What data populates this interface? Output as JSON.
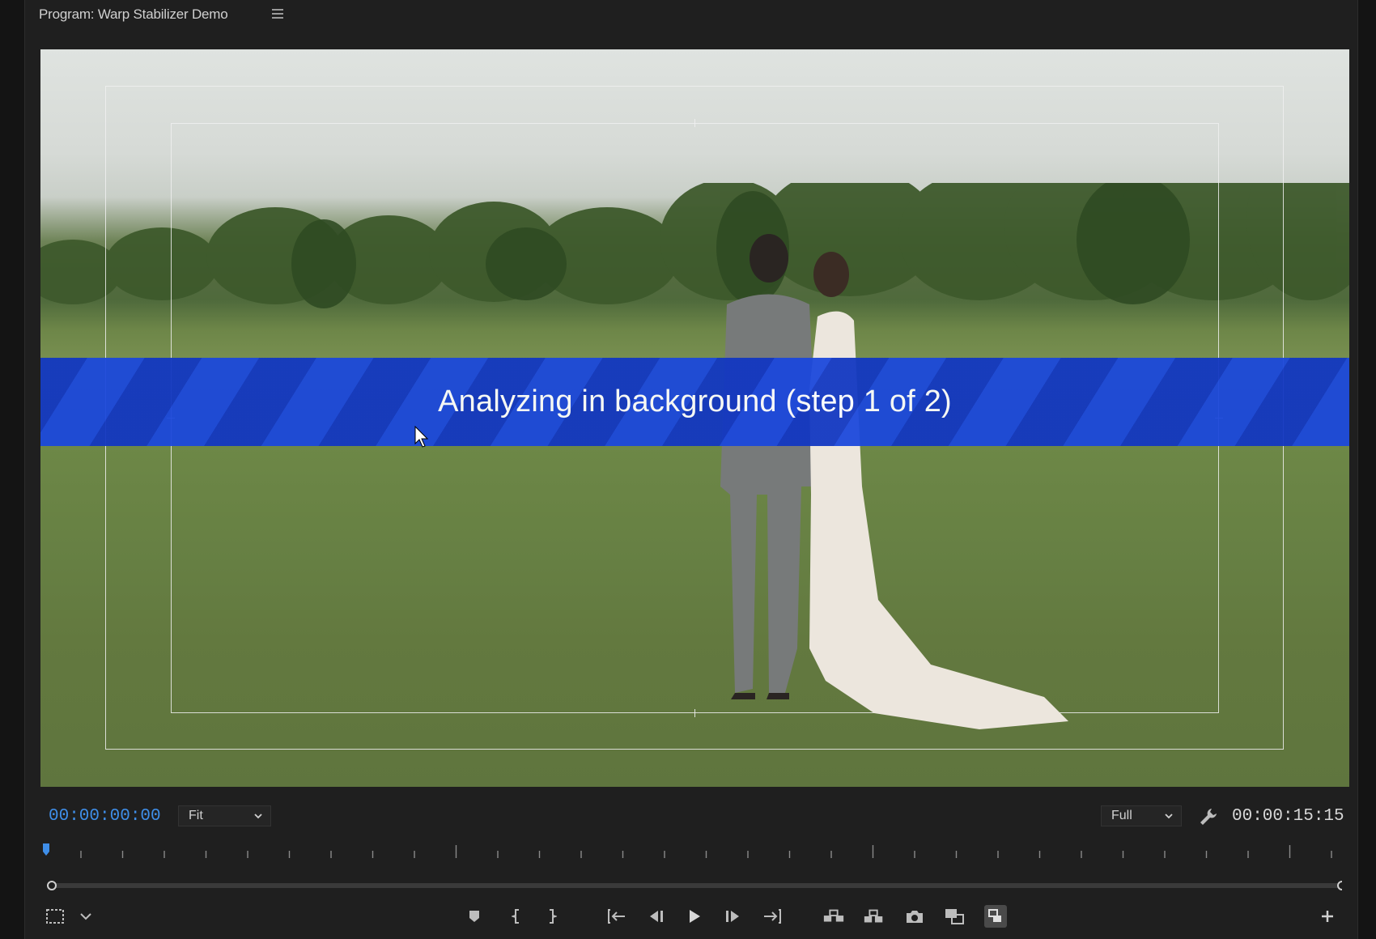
{
  "panel": {
    "title": "Program: Warp Stabilizer Demo",
    "menu_icon": "hamburger-icon"
  },
  "video": {
    "overlay_message": "Analyzing in background (step 1 of 2)",
    "overlay_color": "#1b48dc"
  },
  "controls": {
    "current_timecode": "00:00:00:00",
    "zoom_select": {
      "value": "Fit"
    },
    "resolution_select": {
      "value": "Full"
    },
    "settings_icon": "wrench-icon",
    "duration": "00:00:15:15",
    "timecode_color": "#3f8ee8",
    "playhead_position": 0.0
  },
  "transport": [
    {
      "name": "add-marker-button",
      "icon": "marker-icon"
    },
    {
      "name": "mark-in-button",
      "icon": "mark-in-icon"
    },
    {
      "name": "mark-out-button",
      "icon": "mark-out-icon"
    },
    {
      "name": "go-to-in-button",
      "icon": "go-to-in-icon"
    },
    {
      "name": "step-back-button",
      "icon": "step-back-icon"
    },
    {
      "name": "play-button",
      "icon": "play-icon"
    },
    {
      "name": "step-forward-button",
      "icon": "step-forward-icon"
    },
    {
      "name": "go-to-out-button",
      "icon": "go-to-out-icon"
    },
    {
      "name": "lift-button",
      "icon": "lift-icon"
    },
    {
      "name": "extract-button",
      "icon": "extract-icon"
    },
    {
      "name": "export-frame-button",
      "icon": "camera-icon"
    },
    {
      "name": "comparison-view-button",
      "icon": "comparison-icon"
    },
    {
      "name": "multi-camera-button",
      "icon": "multicam-icon"
    }
  ]
}
